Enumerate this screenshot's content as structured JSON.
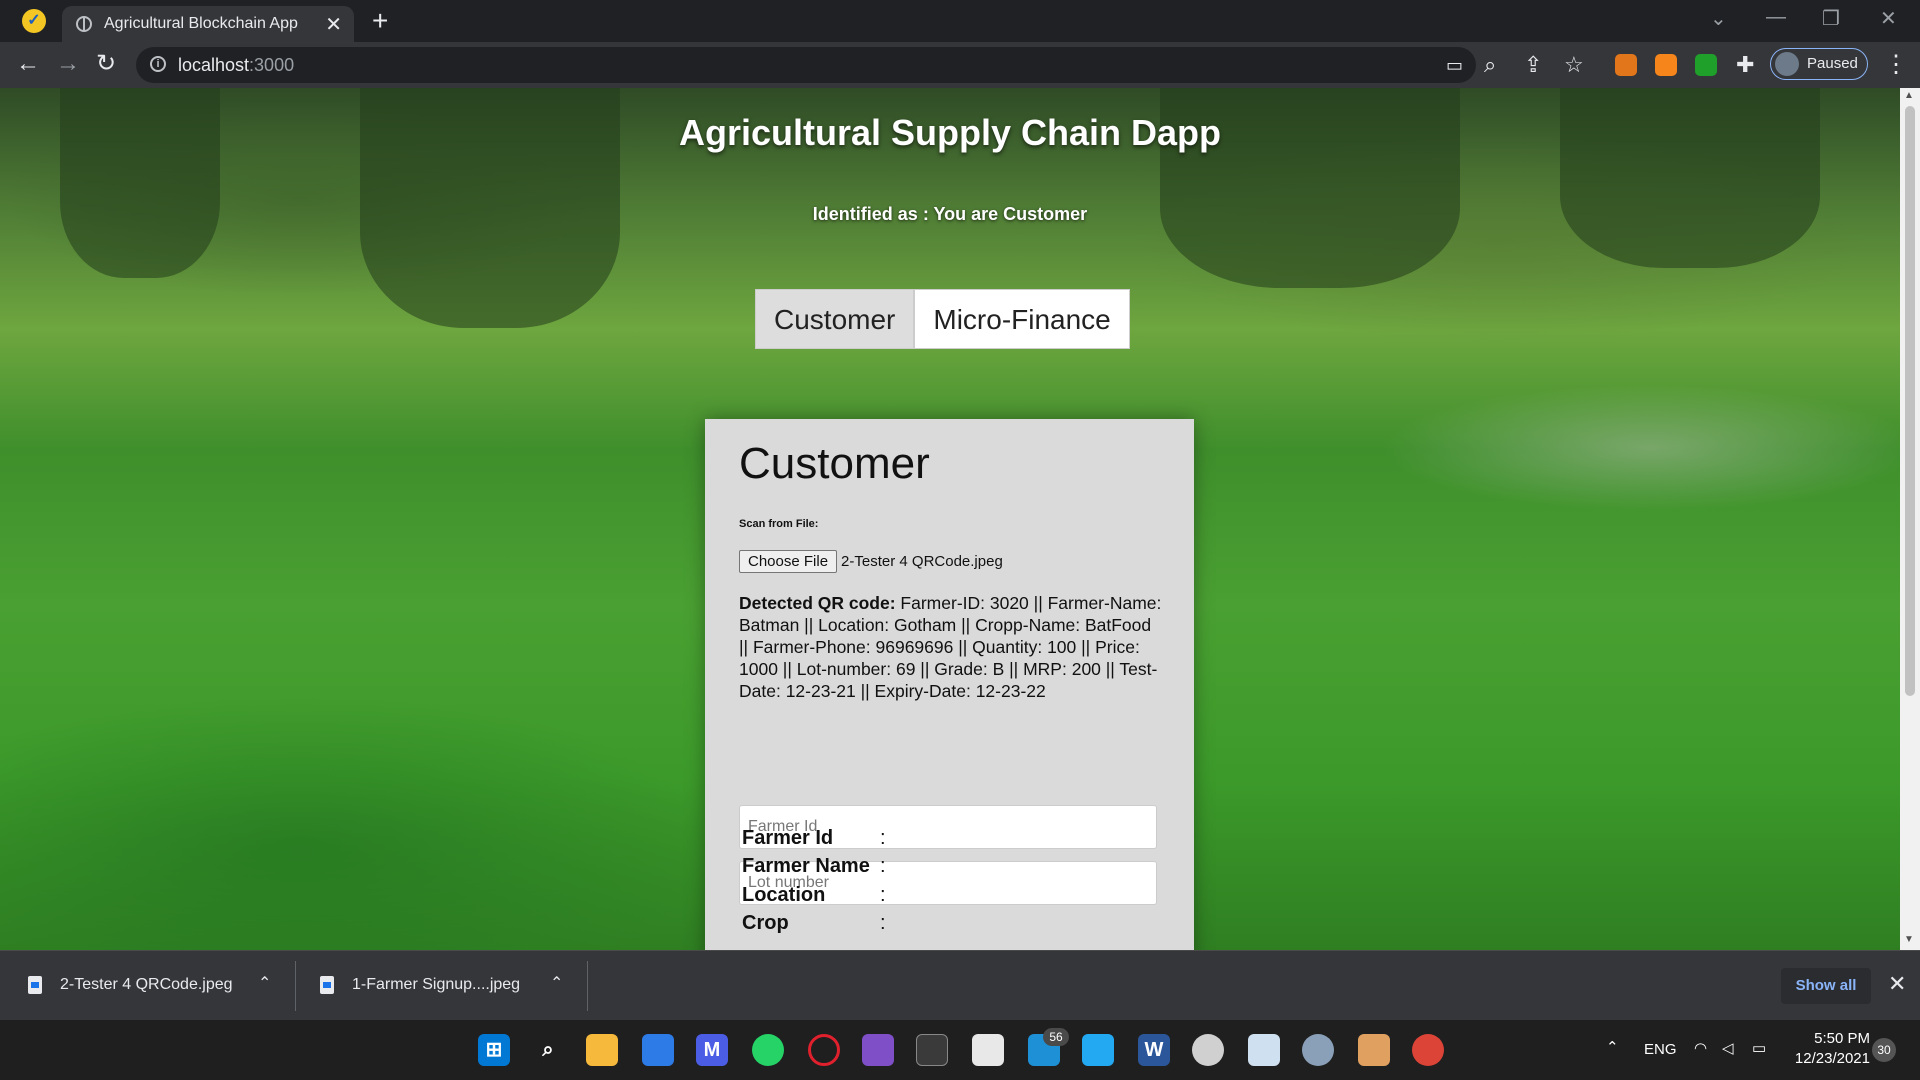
{
  "browser": {
    "tab_title": "Agricultural Blockchain App",
    "tab_close": "✕",
    "new_tab": "+",
    "url_host": "localhost",
    "url_port": ":3000",
    "profile_status": "Paused"
  },
  "page": {
    "title": "Agricultural Supply Chain Dapp",
    "identity": "Identified as : You are Customer",
    "tabs": [
      {
        "label": "Customer",
        "active": true
      },
      {
        "label": "Micro-Finance",
        "active": false
      }
    ]
  },
  "customer": {
    "heading": "Customer",
    "scan_label": "Scan from File:",
    "choose_file_label": "Choose File",
    "chosen_file": "2-Tester 4 QRCode.jpeg",
    "qr_label": "Detected QR code:",
    "qr_value": " Farmer-ID: 3020 || Farmer-Name: Batman || Location: Gotham || Cropp-Name: BatFood || Farmer-Phone: 96969696 || Quantity: 100 || Price: 1000 || Lot-number: 69 || Grade: B || MRP: 200 || Test-Date: 12-23-21 || Expiry-Date: 12-23-22",
    "farmer_id_placeholder": "Farmer Id",
    "lot_number_placeholder": "Lot number",
    "fields": [
      {
        "label": "Farmer Id",
        "sep": ":"
      },
      {
        "label": "Farmer Name",
        "sep": ":"
      },
      {
        "label": "Location",
        "sep": ":"
      },
      {
        "label": "Crop",
        "sep": ":"
      }
    ]
  },
  "downloads": [
    {
      "name": "2-Tester 4 QRCode.jpeg"
    },
    {
      "name": "1-Farmer Signup....jpeg"
    }
  ],
  "downloads_show_all": "Show all",
  "taskbar": {
    "badge_count": "56",
    "language": "ENG",
    "time": "5:50 PM",
    "date": "12/23/2021",
    "notification_count": "30"
  }
}
